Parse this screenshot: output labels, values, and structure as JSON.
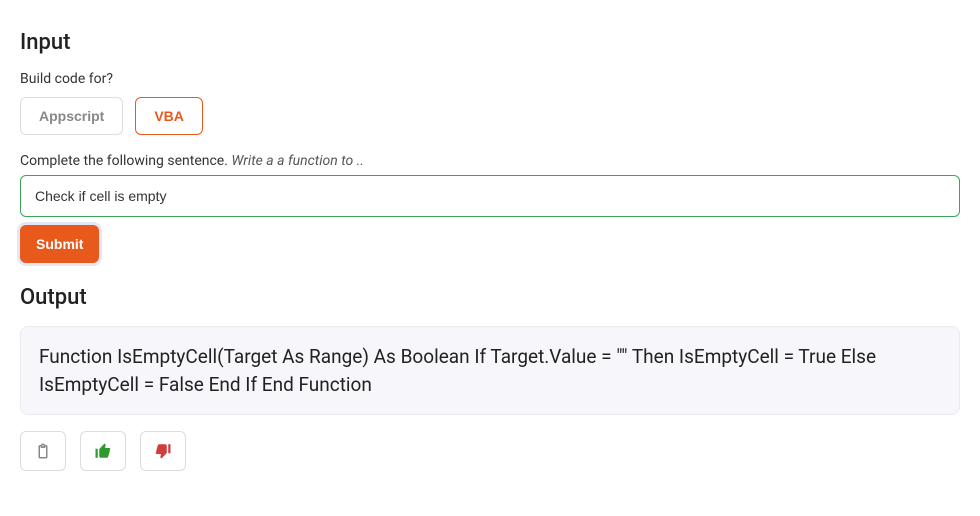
{
  "input": {
    "heading": "Input",
    "build_label": "Build code for?",
    "options": {
      "appscript": "Appscript",
      "vba": "VBA"
    },
    "selected": "vba",
    "prompt_label_plain": "Complete the following sentence. ",
    "prompt_label_italic": "Write a a function to ..",
    "text_value": "Check if cell is empty",
    "submit_label": "Submit"
  },
  "output": {
    "heading": "Output",
    "code": "Function IsEmptyCell(Target As Range) As Boolean If Target.Value = \"\" Then IsEmptyCell = True Else IsEmptyCell = False End If End Function"
  },
  "actions": {
    "copy": "copy",
    "thumbs_up": "thumbs-up",
    "thumbs_down": "thumbs-down"
  },
  "colors": {
    "accent": "#e8591c",
    "input_border": "#3aa655",
    "thumbs_up": "#2e9a2e",
    "thumbs_down": "#d23c3c"
  }
}
